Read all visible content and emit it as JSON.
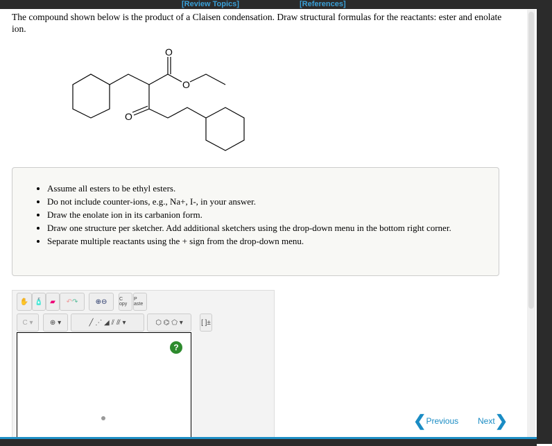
{
  "header": {
    "review_topics": "[Review Topics]",
    "references": "[References]"
  },
  "question": "The compound shown below is the product of a Claisen condensation. Draw structural formulas for the reactants: ester and enolate ion.",
  "molecule": {
    "atom_labels": [
      "O",
      "O",
      "O"
    ]
  },
  "instructions": [
    "Assume all esters to be ethyl esters.",
    "Do not include counter-ions, e.g., Na+, I-, in your answer.",
    "Draw the enolate ion in its carbanion form.",
    "Draw one structure per sketcher. Add additional sketchers using the drop-down menu in the bottom right corner.",
    "Separate multiple reactants using the + sign from the drop-down menu."
  ],
  "sketcher": {
    "copy": "C opy",
    "paste": "P aste",
    "atom": "C",
    "help": "?",
    "bracket": "[ ]±"
  },
  "nav": {
    "previous": "Previous",
    "next": "Next"
  }
}
